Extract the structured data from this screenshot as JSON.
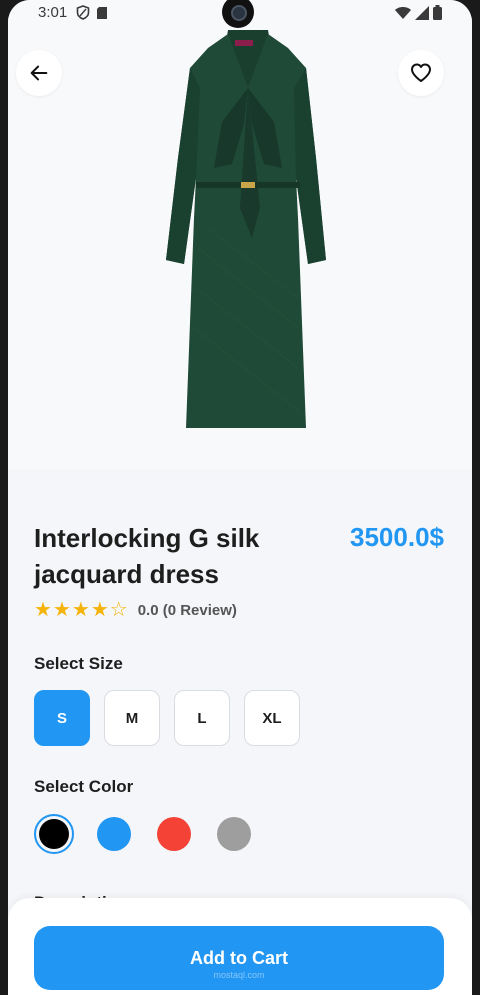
{
  "status_bar": {
    "time": "3:01",
    "left_icons": [
      "shield-icon",
      "sd-card-icon"
    ],
    "right_icons": [
      "wifi-icon",
      "signal-icon",
      "battery-icon"
    ]
  },
  "header": {
    "back_icon": "arrow-left-icon",
    "favorite_icon": "heart-outline-icon"
  },
  "product": {
    "title": "Interlocking G silk jacquard dress",
    "price": "3500.0$",
    "rating_stars": 3.5,
    "rating_text": "0.0 (0 Review)",
    "dress_color": "#1f4a37"
  },
  "sizes": {
    "label": "Select Size",
    "options": [
      "S",
      "M",
      "L",
      "XL"
    ],
    "selected": "S"
  },
  "colors": {
    "label": "Select Color",
    "options": [
      "#000000",
      "#2196f3",
      "#f44336",
      "#9e9e9e"
    ],
    "selected_index": 0
  },
  "description": {
    "label": "Description"
  },
  "cart": {
    "button_label": "Add to Cart",
    "watermark": "mostaql.com"
  },
  "theme": {
    "accent": "#2196f3",
    "star": "#f5b40b"
  }
}
